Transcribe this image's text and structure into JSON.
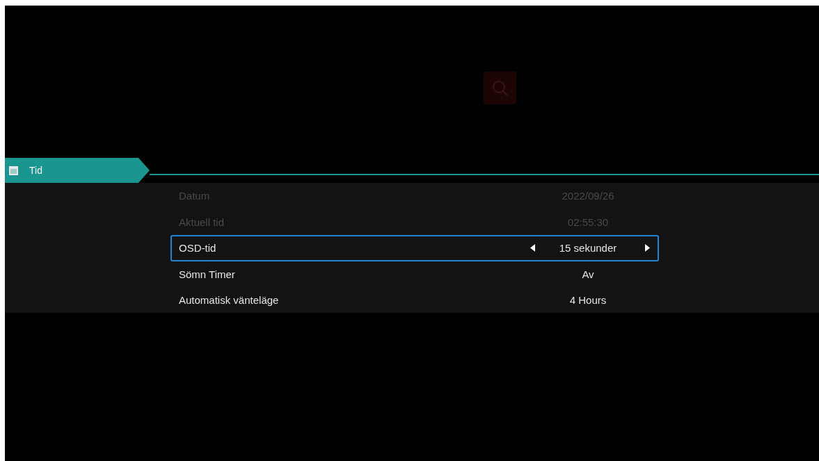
{
  "section_tab": {
    "label": "Tid",
    "selected": true
  },
  "settings": [
    {
      "label": "Datum",
      "value": "2022/09/26",
      "disabled": true,
      "selected": false
    },
    {
      "label": "Aktuell tid",
      "value": "02:55:30",
      "disabled": true,
      "selected": false
    },
    {
      "label": "OSD-tid",
      "value": "15 sekunder",
      "disabled": false,
      "selected": true
    },
    {
      "label": "Sömn Timer",
      "value": "Av",
      "disabled": false,
      "selected": false
    },
    {
      "label": "Automatisk vänteläge",
      "value": "4 Hours",
      "disabled": false,
      "selected": false
    }
  ]
}
